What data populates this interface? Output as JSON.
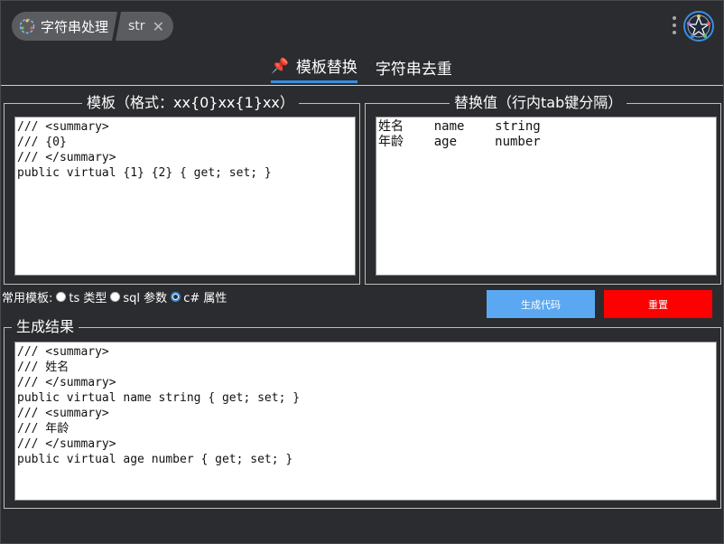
{
  "breadcrumb": {
    "app_title": "字符串处理",
    "sub_title": "str",
    "close_symbol": "✕"
  },
  "tabs": [
    {
      "label": "模板替换",
      "active": true,
      "icon": "pin-icon"
    },
    {
      "label": "字符串去重",
      "active": false
    }
  ],
  "template": {
    "legend": "模板（格式：xx{0}xx{1}xx）",
    "content": "/// <summary>\n/// {0}\n/// </summary>\npublic virtual {1} {2} { get; set; }"
  },
  "replace": {
    "legend": "替换值（行内tab键分隔）",
    "content": "姓名    name    string\n年龄    age     number"
  },
  "presets": {
    "label": "常用模板:",
    "options": [
      {
        "label": "ts 类型",
        "checked": false
      },
      {
        "label": "sql 参数",
        "checked": false
      },
      {
        "label": "c# 属性",
        "checked": true
      }
    ]
  },
  "buttons": {
    "generate": "生成代码",
    "reset": "重置"
  },
  "result": {
    "legend": "生成结果",
    "content": "/// <summary>\n/// 姓名\n/// </summary>\npublic virtual name string { get; set; }\n/// <summary>\n/// 年龄\n/// </summary>\npublic virtual age number { get; set; }"
  },
  "colors": {
    "accent": "#3a8de0",
    "generate_bg": "#5aa8f2",
    "reset_bg": "#ff0000",
    "background": "#2b2c2f"
  }
}
